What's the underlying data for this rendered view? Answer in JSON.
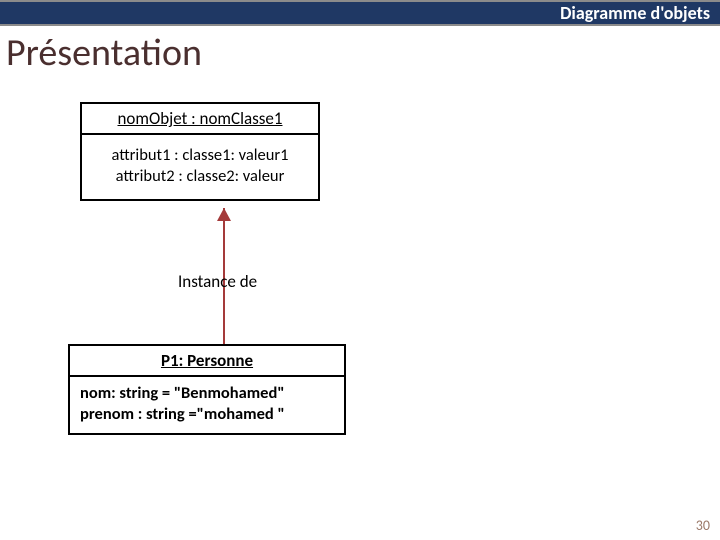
{
  "header": {
    "title": "Diagramme d'objets"
  },
  "section": {
    "title": "Présentation"
  },
  "box1": {
    "title": "nomObjet : nomClasse1",
    "line1": "attribut1 : classe1: valeur1",
    "line2": "attribut2 : classe2: valeur"
  },
  "arrow": {
    "label": "Instance de"
  },
  "box2": {
    "title": "P1: Personne",
    "line1": "nom: string = \"Benmohamed\"",
    "line2": "prenom : string =\"mohamed \""
  },
  "page": {
    "number": "30"
  }
}
